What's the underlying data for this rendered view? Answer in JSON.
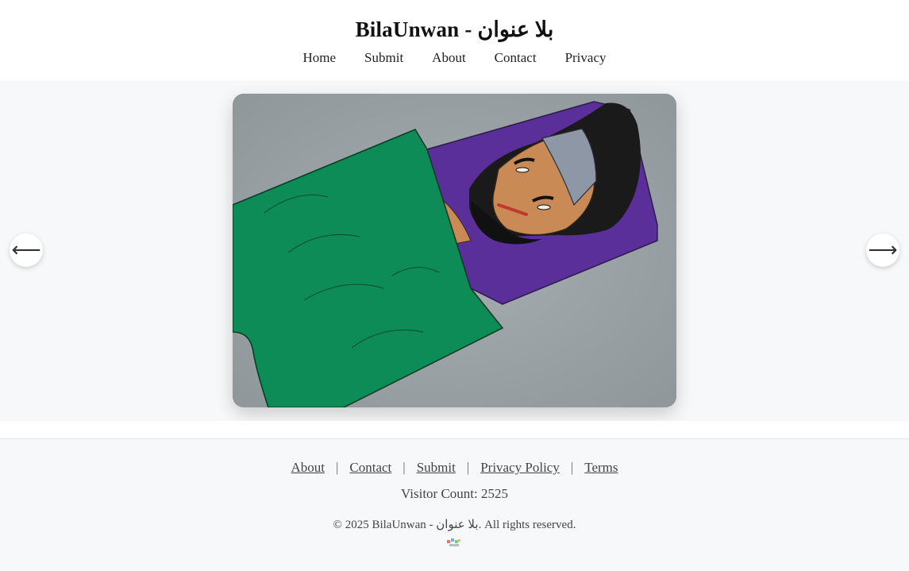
{
  "header": {
    "title": "BilaUnwan - بلا عنوان",
    "nav": [
      "Home",
      "Submit",
      "About",
      "Contact",
      "Privacy"
    ]
  },
  "carousel": {
    "prev_icon": "arrow-left-icon",
    "next_icon": "arrow-right-icon",
    "prev_glyph": "⟵",
    "next_glyph": "⟶"
  },
  "footer": {
    "links": [
      "About",
      "Contact",
      "Submit",
      "Privacy Policy",
      "Terms"
    ],
    "separator": "|",
    "visitor_count": "Visitor Count: 2525",
    "copyright": "© 2025 BilaUnwan - بلا عنوان. All rights reserved."
  },
  "colors": {
    "background": "#f7f8f9",
    "header_bg": "#ffffff",
    "text": "#222222"
  }
}
